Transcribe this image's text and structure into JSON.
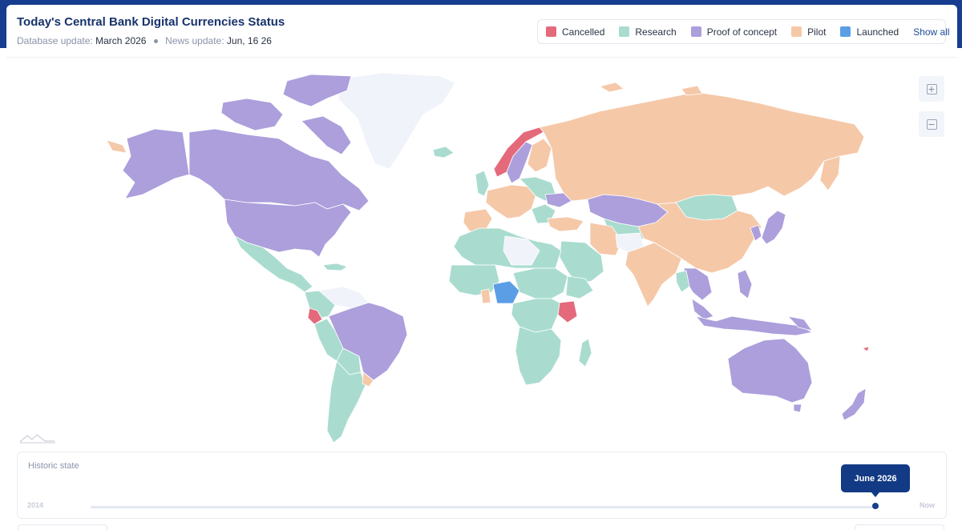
{
  "header": {
    "title": "Today's Central Bank Digital Currencies Status",
    "database_label": "Database update:",
    "database_value": "March 2026",
    "news_label": "News update:",
    "news_value": "Jun, 16 26"
  },
  "legend": {
    "items": [
      {
        "label": "Cancelled",
        "color": "#e46a7b"
      },
      {
        "label": "Research",
        "color": "#a9dccf"
      },
      {
        "label": "Proof of concept",
        "color": "#ac9fdc"
      },
      {
        "label": "Pilot",
        "color": "#f5c8a8"
      },
      {
        "label": "Launched",
        "color": "#5b9ee6"
      }
    ],
    "show_all": "Show all"
  },
  "map": {
    "colors": {
      "no_data": "#f0f3f9",
      "border": "#ffffff"
    },
    "zoom_in_icon": "plus-icon",
    "zoom_out_icon": "minus-icon",
    "zoom_in_symbol": "+",
    "zoom_out_symbol": "−"
  },
  "timeline": {
    "label": "Historic state",
    "start": "2014",
    "end": "Now",
    "current": "June 2026",
    "position": 0.995
  }
}
